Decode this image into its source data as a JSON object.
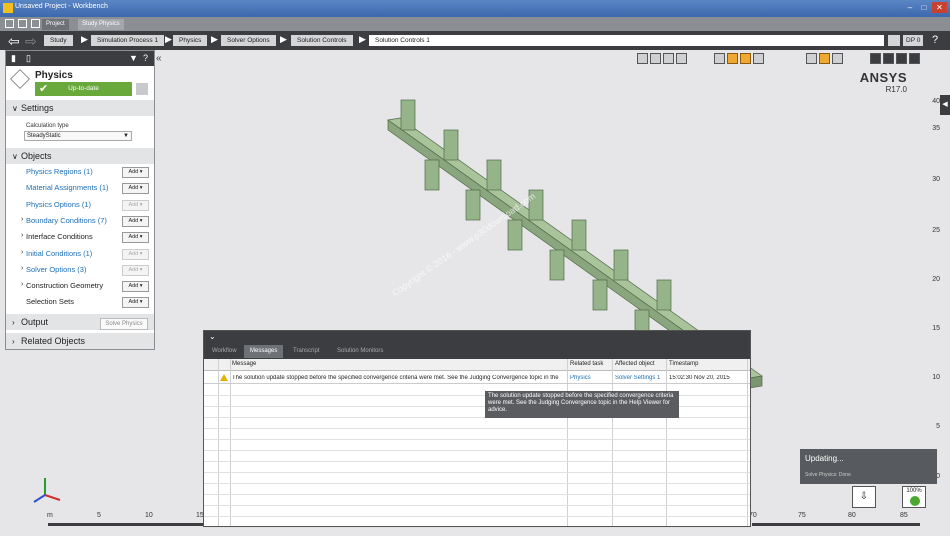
{
  "window": {
    "title": "Unsaved Project - Workbench"
  },
  "tabs": [
    {
      "label": "Project"
    },
    {
      "label": "Study Physics"
    }
  ],
  "breadcrumb": [
    "Study",
    "Simulation Process 1",
    "Physics",
    "Solver Options",
    "Solution Controls",
    "Solution Controls 1"
  ],
  "dp_label": "DP 0",
  "panel": {
    "title": "Physics",
    "status": "Up-to-date",
    "settings_label": "Settings",
    "calc_type_label": "Calculation type",
    "calc_type_value": "SteadyStatic",
    "objects_label": "Objects",
    "output_label": "Output",
    "solve_label": "Solve Physics",
    "related_label": "Related Objects",
    "add_label": "Add",
    "objects": [
      {
        "name": "Physics Regions (1)",
        "link": true,
        "chev": false,
        "add_enabled": true
      },
      {
        "name": "Material Assignments (1)",
        "link": true,
        "chev": false,
        "add_enabled": true
      },
      {
        "name": "Physics Options (1)",
        "link": true,
        "chev": false,
        "add_enabled": false
      },
      {
        "name": "Boundary Conditions (7)",
        "link": true,
        "chev": true,
        "add_enabled": true
      },
      {
        "name": "Interface Conditions",
        "link": false,
        "chev": true,
        "add_enabled": true
      },
      {
        "name": "Initial Conditions (1)",
        "link": true,
        "chev": true,
        "add_enabled": false
      },
      {
        "name": "Solver Options (3)",
        "link": true,
        "chev": true,
        "add_enabled": false
      },
      {
        "name": "Construction Geometry",
        "link": false,
        "chev": true,
        "add_enabled": true
      },
      {
        "name": "Selection Sets",
        "link": false,
        "chev": false,
        "add_enabled": true
      }
    ]
  },
  "brand": {
    "name": "ANSYS",
    "version": "R17.0"
  },
  "ruler_v": [
    "40",
    "35",
    "30",
    "25",
    "20",
    "15",
    "10",
    "5",
    "0"
  ],
  "ruler_h": [
    "m",
    "5",
    "10",
    "15",
    "70",
    "75",
    "80",
    "85"
  ],
  "watermark": "Copyright © 2016 - www.p30download.com",
  "messages": {
    "tabs": [
      "Workflow",
      "Messages",
      "Transcript",
      "Solution Monitors"
    ],
    "active_tab": 1,
    "columns": [
      "Message",
      "Related task",
      "Affected object",
      "Timestamp"
    ],
    "rows": [
      {
        "message": "The solution update stopped before the specified convergence criteria were met. See the Judging Convergence topic in the",
        "task": "Physics",
        "object": "Solver Settings 1",
        "timestamp": "15:02:30 Nov 20, 2015"
      }
    ],
    "tooltip": "The solution update stopped before the specified convergence criteria were met. See the Judging Convergence topic in the Help Viewer for advice."
  },
  "progress": {
    "title": "Updating...",
    "detail": "Solve Physics: Done",
    "percent_label": "100%",
    "percent": 100
  },
  "colors": {
    "accent": "#69a83a",
    "dark": "#3b3d41",
    "link": "#1e6fb6",
    "model": "#96b489"
  }
}
